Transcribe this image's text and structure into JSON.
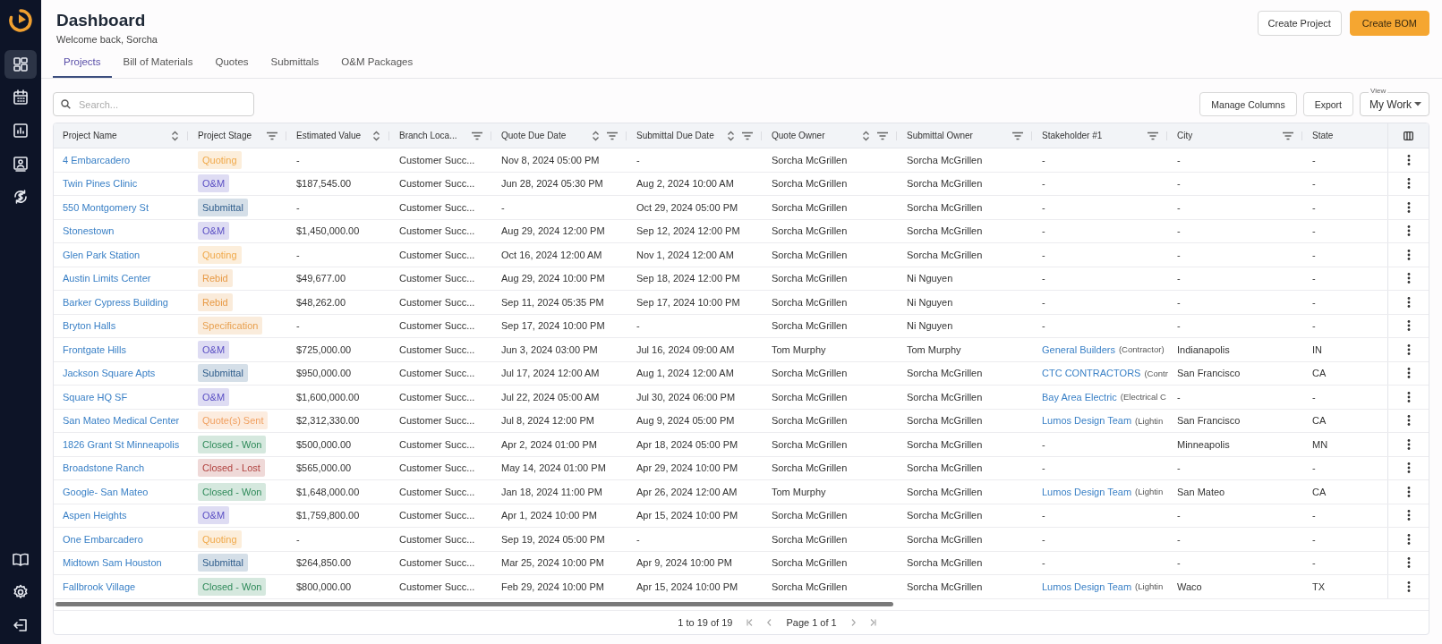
{
  "sidebar": {
    "top_items": [
      {
        "kind": "grid",
        "selected": true
      },
      {
        "kind": "calendar",
        "selected": false
      },
      {
        "kind": "chart",
        "selected": false
      },
      {
        "kind": "contacts",
        "selected": false
      },
      {
        "kind": "billing",
        "selected": false
      }
    ],
    "bottom_items": [
      {
        "kind": "book",
        "selected": false
      },
      {
        "kind": "settings",
        "selected": false
      },
      {
        "kind": "logout",
        "selected": false
      }
    ]
  },
  "header": {
    "title": "Dashboard",
    "subtitle": "Welcome back, Sorcha",
    "buttons": [
      {
        "label": "Create Project",
        "kind": "secondary"
      },
      {
        "label": "Create BOM",
        "kind": "primary"
      }
    ]
  },
  "tabs": [
    {
      "label": "Projects",
      "selected": true
    },
    {
      "label": "Bill of Materials",
      "selected": false
    },
    {
      "label": "Quotes",
      "selected": false
    },
    {
      "label": "Submittals",
      "selected": false
    },
    {
      "label": "O&M Packages",
      "selected": false
    }
  ],
  "toolbar": {
    "search": {
      "placeholder": "Search..."
    },
    "buttons": [
      "Manage Columns",
      "Export"
    ],
    "view": {
      "label": "View",
      "value": "My Work"
    }
  },
  "table": {
    "columns": [
      {
        "label": "Project Name",
        "sortable": true,
        "filterable": false
      },
      {
        "label": "Project Stage",
        "sortable": false,
        "filterable": true
      },
      {
        "label": "Estimated Value",
        "sortable": true,
        "filterable": false
      },
      {
        "label": "Branch Loca...",
        "sortable": false,
        "filterable": true
      },
      {
        "label": "Quote Due Date",
        "sortable": true,
        "filterable": true
      },
      {
        "label": "Submittal Due Date",
        "sortable": true,
        "filterable": true
      },
      {
        "label": "Quote Owner",
        "sortable": true,
        "filterable": true
      },
      {
        "label": "Submittal Owner",
        "sortable": false,
        "filterable": true
      },
      {
        "label": "Stakeholder #1",
        "sortable": false,
        "filterable": true
      },
      {
        "label": "City",
        "sortable": false,
        "filterable": true
      },
      {
        "label": "State",
        "sortable": false,
        "filterable": false
      }
    ],
    "rows": [
      {
        "name": "4 Embarcadero",
        "stage": {
          "label": "Quoting",
          "color": "#f0a94a"
        },
        "value": "-",
        "branch": "Customer Succ...",
        "quote_due": "Nov 8, 2024 05:00 PM",
        "submittal_due": "-",
        "quote_owner": "Sorcha McGrillen",
        "submittal_owner": "Sorcha McGrillen",
        "stakeholder": {
          "kind": "text",
          "text": "-"
        },
        "city": "-",
        "state": "-"
      },
      {
        "name": "Twin Pines Clinic",
        "stage": {
          "label": "O&M",
          "color": "#5b4fc4"
        },
        "value": "$187,545.00",
        "branch": "Customer Succ...",
        "quote_due": "Jun 28, 2024 05:30 PM",
        "submittal_due": "Aug 2, 2024 10:00 AM",
        "quote_owner": "Sorcha McGrillen",
        "submittal_owner": "Sorcha McGrillen",
        "stakeholder": {
          "kind": "text",
          "text": "-"
        },
        "city": "-",
        "state": "-"
      },
      {
        "name": "550 Montgomery St",
        "stage": {
          "label": "Submittal",
          "color": "#2f5d8c"
        },
        "value": "-",
        "branch": "Customer Succ...",
        "quote_due": "-",
        "submittal_due": "Oct 29, 2024 05:00 PM",
        "quote_owner": "Sorcha McGrillen",
        "submittal_owner": "Sorcha McGrillen",
        "stakeholder": {
          "kind": "text",
          "text": "-"
        },
        "city": "-",
        "state": "-"
      },
      {
        "name": "Stonestown",
        "stage": {
          "label": "O&M",
          "color": "#5b4fc4"
        },
        "value": "$1,450,000.00",
        "branch": "Customer Succ...",
        "quote_due": "Aug 29, 2024 12:00 PM",
        "submittal_due": "Sep 12, 2024 12:00 PM",
        "quote_owner": "Sorcha McGrillen",
        "submittal_owner": "Sorcha McGrillen",
        "stakeholder": {
          "kind": "text",
          "text": "-"
        },
        "city": "-",
        "state": "-"
      },
      {
        "name": "Glen Park Station",
        "stage": {
          "label": "Quoting",
          "color": "#f0a94a"
        },
        "value": "-",
        "branch": "Customer Succ...",
        "quote_due": "Oct 16, 2024 12:00 AM",
        "submittal_due": "Nov 1, 2024 12:00 AM",
        "quote_owner": "Sorcha McGrillen",
        "submittal_owner": "Sorcha McGrillen",
        "stakeholder": {
          "kind": "text",
          "text": "-"
        },
        "city": "-",
        "state": "-"
      },
      {
        "name": "Austin Limits Center",
        "stage": {
          "label": "Rebid",
          "color": "#e89a45"
        },
        "value": "$49,677.00",
        "branch": "Customer Succ...",
        "quote_due": "Aug 29, 2024 10:00 PM",
        "submittal_due": "Sep 18, 2024 12:00 PM",
        "quote_owner": "Sorcha McGrillen",
        "submittal_owner": "Ni Nguyen",
        "stakeholder": {
          "kind": "text",
          "text": "-"
        },
        "city": "-",
        "state": "-"
      },
      {
        "name": "Barker Cypress Building",
        "stage": {
          "label": "Rebid",
          "color": "#e89a45"
        },
        "value": "$48,262.00",
        "branch": "Customer Succ...",
        "quote_due": "Sep 11, 2024 05:35 PM",
        "submittal_due": "Sep 17, 2024 10:00 PM",
        "quote_owner": "Sorcha McGrillen",
        "submittal_owner": "Ni Nguyen",
        "stakeholder": {
          "kind": "text",
          "text": "-"
        },
        "city": "-",
        "state": "-"
      },
      {
        "name": "Bryton Halls",
        "stage": {
          "label": "Specification",
          "color": "#e8a04f"
        },
        "value": "-",
        "branch": "Customer Succ...",
        "quote_due": "Sep 17, 2024 10:00 PM",
        "submittal_due": "-",
        "quote_owner": "Sorcha McGrillen",
        "submittal_owner": "Ni Nguyen",
        "stakeholder": {
          "kind": "text",
          "text": "-"
        },
        "city": "-",
        "state": "-"
      },
      {
        "name": "Frontgate Hills",
        "stage": {
          "label": "O&M",
          "color": "#5b4fc4"
        },
        "value": "$725,000.00",
        "branch": "Customer Succ...",
        "quote_due": "Jun 3, 2024 03:00 PM",
        "submittal_due": "Jul 16, 2024 09:00 AM",
        "quote_owner": "Tom Murphy",
        "submittal_owner": "Tom Murphy",
        "stakeholder": {
          "kind": "link",
          "name": "General Builders",
          "role": "(Contractor)"
        },
        "city": "Indianapolis",
        "state": "IN"
      },
      {
        "name": "Jackson Square Apts",
        "stage": {
          "label": "Submittal",
          "color": "#2f5d8c"
        },
        "value": "$950,000.00",
        "branch": "Customer Succ...",
        "quote_due": "Jul 17, 2024 12:00 AM",
        "submittal_due": "Aug 1, 2024 12:00 AM",
        "quote_owner": "Sorcha McGrillen",
        "submittal_owner": "Sorcha McGrillen",
        "stakeholder": {
          "kind": "link",
          "name": "CTC CONTRACTORS",
          "role": "(Contr"
        },
        "city": "San Francisco",
        "state": "CA"
      },
      {
        "name": "Square HQ SF",
        "stage": {
          "label": "O&M",
          "color": "#5b4fc4"
        },
        "value": "$1,600,000.00",
        "branch": "Customer Succ...",
        "quote_due": "Jul 22, 2024 05:00 AM",
        "submittal_due": "Jul 30, 2024 06:00 PM",
        "quote_owner": "Sorcha McGrillen",
        "submittal_owner": "Sorcha McGrillen",
        "stakeholder": {
          "kind": "link",
          "name": "Bay Area Electric",
          "role": "(Electrical C"
        },
        "city": "-",
        "state": "-"
      },
      {
        "name": "San Mateo Medical Center",
        "stage": {
          "label": "Quote(s) Sent",
          "color": "#f0a060"
        },
        "value": "$2,312,330.00",
        "branch": "Customer Succ...",
        "quote_due": "Jul 8, 2024 12:00 PM",
        "submittal_due": "Aug 9, 2024 05:00 PM",
        "quote_owner": "Sorcha McGrillen",
        "submittal_owner": "Sorcha McGrillen",
        "stakeholder": {
          "kind": "link",
          "name": "Lumos Design Team",
          "role": "(Lightin"
        },
        "city": "San Francisco",
        "state": "CA"
      },
      {
        "name": "1826 Grant St Minneapolis",
        "stage": {
          "label": "Closed - Won",
          "color": "#2f8a5a"
        },
        "value": "$500,000.00",
        "branch": "Customer Succ...",
        "quote_due": "Apr 2, 2024 01:00 PM",
        "submittal_due": "Apr 18, 2024 05:00 PM",
        "quote_owner": "Sorcha McGrillen",
        "submittal_owner": "Sorcha McGrillen",
        "stakeholder": {
          "kind": "text",
          "text": "-"
        },
        "city": "Minneapolis",
        "state": "MN"
      },
      {
        "name": "Broadstone Ranch",
        "stage": {
          "label": "Closed - Lost",
          "color": "#b0413e"
        },
        "value": "$565,000.00",
        "branch": "Customer Succ...",
        "quote_due": "May 14, 2024 01:00 PM",
        "submittal_due": "Apr 29, 2024 10:00 PM",
        "quote_owner": "Sorcha McGrillen",
        "submittal_owner": "Sorcha McGrillen",
        "stakeholder": {
          "kind": "text",
          "text": "-"
        },
        "city": "-",
        "state": "-"
      },
      {
        "name": "Google- San Mateo",
        "stage": {
          "label": "Closed - Won",
          "color": "#2f8a5a"
        },
        "value": "$1,648,000.00",
        "branch": "Customer Succ...",
        "quote_due": "Jan 18, 2024 11:00 PM",
        "submittal_due": "Apr 26, 2024 12:00 AM",
        "quote_owner": "Tom Murphy",
        "submittal_owner": "Sorcha McGrillen",
        "stakeholder": {
          "kind": "link",
          "name": "Lumos Design Team",
          "role": "(Lightin"
        },
        "city": "San Mateo",
        "state": "CA"
      },
      {
        "name": "Aspen Heights",
        "stage": {
          "label": "O&M",
          "color": "#5b4fc4"
        },
        "value": "$1,759,800.00",
        "branch": "Customer Succ...",
        "quote_due": "Apr 1, 2024 10:00 PM",
        "submittal_due": "Apr 15, 2024 10:00 PM",
        "quote_owner": "Sorcha McGrillen",
        "submittal_owner": "Sorcha McGrillen",
        "stakeholder": {
          "kind": "text",
          "text": "-"
        },
        "city": "-",
        "state": "-"
      },
      {
        "name": "One Embarcadero",
        "stage": {
          "label": "Quoting",
          "color": "#f0a94a"
        },
        "value": "-",
        "branch": "Customer Succ...",
        "quote_due": "Sep 19, 2024 05:00 PM",
        "submittal_due": "-",
        "quote_owner": "Sorcha McGrillen",
        "submittal_owner": "Sorcha McGrillen",
        "stakeholder": {
          "kind": "text",
          "text": "-"
        },
        "city": "-",
        "state": "-"
      },
      {
        "name": "Midtown Sam Houston",
        "stage": {
          "label": "Submittal",
          "color": "#2f5d8c"
        },
        "value": "$264,850.00",
        "branch": "Customer Succ...",
        "quote_due": "Mar 25, 2024 10:00 PM",
        "submittal_due": "Apr 9, 2024 10:00 PM",
        "quote_owner": "Sorcha McGrillen",
        "submittal_owner": "Sorcha McGrillen",
        "stakeholder": {
          "kind": "text",
          "text": "-"
        },
        "city": "-",
        "state": "-"
      },
      {
        "name": "Fallbrook Village",
        "stage": {
          "label": "Closed - Won",
          "color": "#2f8a5a"
        },
        "value": "$800,000.00",
        "branch": "Customer Succ...",
        "quote_due": "Feb 29, 2024 10:00 PM",
        "submittal_due": "Apr 15, 2024 10:00 PM",
        "quote_owner": "Sorcha McGrillen",
        "submittal_owner": "Sorcha McGrillen",
        "stakeholder": {
          "kind": "link",
          "name": "Lumos Design Team",
          "role": "(Lightin"
        },
        "city": "Waco",
        "state": "TX"
      }
    ]
  },
  "pagination": {
    "range": "1 to 19 of 19",
    "page": "Page 1 of 1"
  }
}
